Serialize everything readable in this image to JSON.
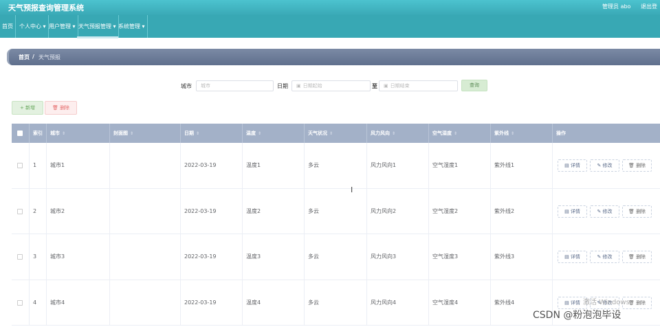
{
  "header": {
    "title": "天气预报查询管理系统",
    "admin": "管理员 abo",
    "logout": "退出登"
  },
  "nav": [
    "首页",
    "个人中心 ▾",
    "用户管理 ▾",
    "天气预报管理 ▾",
    "系统管理 ▾"
  ],
  "breadcrumb": {
    "home": "首页",
    "sep": "/",
    "current": "天气预报"
  },
  "search": {
    "city_label": "城市",
    "city_placeholder": "城市",
    "date_label": "日期",
    "start_placeholder": "日期起始",
    "to": "至",
    "end_placeholder": "日期结束",
    "search_btn": "查询"
  },
  "actions": {
    "add": "+ 新增",
    "delete": "删除"
  },
  "table": {
    "headers": [
      "索引",
      "城市",
      "封面图",
      "日期",
      "温度",
      "天气状况",
      "风力风向",
      "空气湿度",
      "紫外线",
      "操作"
    ],
    "rows": [
      {
        "idx": "1",
        "city": "城市1",
        "cover": "",
        "date": "2022-03-19",
        "temp": "温度1",
        "weather": "多云",
        "wind": "风力风向1",
        "humidity": "空气湿度1",
        "uv": "紫外线1"
      },
      {
        "idx": "2",
        "city": "城市2",
        "cover": "",
        "date": "2022-03-19",
        "temp": "温度2",
        "weather": "多云",
        "wind": "风力风向2",
        "humidity": "空气湿度2",
        "uv": "紫外线2"
      },
      {
        "idx": "3",
        "city": "城市3",
        "cover": "",
        "date": "2022-03-19",
        "temp": "温度3",
        "weather": "多云",
        "wind": "风力风向3",
        "humidity": "空气湿度3",
        "uv": "紫外线3"
      },
      {
        "idx": "4",
        "city": "城市4",
        "cover": "",
        "date": "2022-03-19",
        "temp": "温度4",
        "weather": "多云",
        "wind": "风力风向4",
        "humidity": "空气湿度4",
        "uv": "紫外线4"
      }
    ],
    "op_detail": "详情",
    "op_edit": "修改",
    "op_delete": "删除"
  },
  "watermarks": {
    "csdn": "CSDN @粉泡泡毕设",
    "windows": "激活 Windows"
  }
}
